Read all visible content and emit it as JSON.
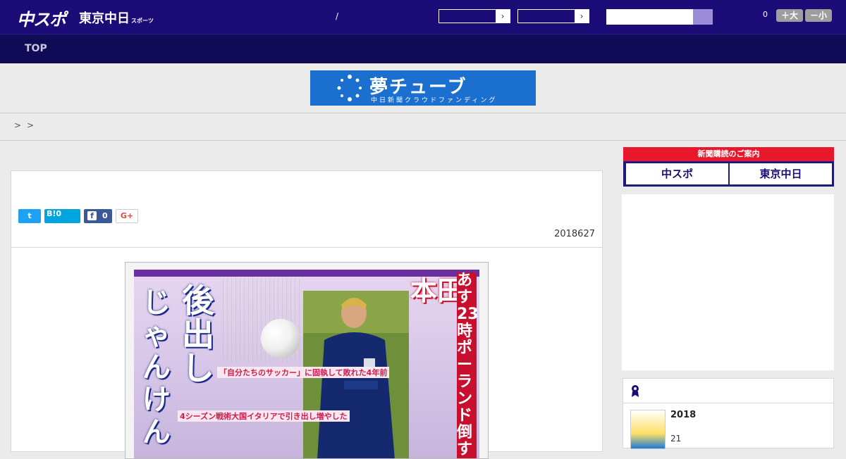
{
  "header": {
    "logo_main": "中スポ",
    "logo_sub": "東京中日",
    "logo_sub_small": "スポーツ",
    "divider": "/",
    "select_arrow_1": "›",
    "select_arrow_2": "›",
    "count": "0",
    "font_larger": "＋大",
    "font_smaller": "－小"
  },
  "nav": {
    "top_label": "TOP"
  },
  "banner": {
    "title": "夢チューブ",
    "subtitle": "中日新聞クラウドファンディング"
  },
  "breadcrumb": {
    "sep1": ">",
    "sep2": ">"
  },
  "article": {
    "share": {
      "twitter_glyph": "t",
      "hatena_label": "B!",
      "hatena_count": "0",
      "facebook_glyph": "f",
      "facebook_count": "0",
      "gplus_label": "G+"
    },
    "date": "2018627",
    "image": {
      "headline_left": "後出し",
      "headline_left2": "じゃんけん",
      "headline_right": "本田",
      "headline_right2": "あす23時ポーランド倒す",
      "caption1": "「自分たちのサッカー」に固執して敗れた4年前",
      "caption2": "4シーズン戦術大国イタリアで引き出し増やした"
    }
  },
  "sidebar": {
    "subscribe_head": "新聞購読のご案内",
    "subscribe_left": "中スポ",
    "subscribe_right": "東京中日",
    "ranking": {
      "item_title": "2018",
      "item_sub": "21"
    }
  },
  "colors": {
    "header": "#1c0c78",
    "nav": "#110a57",
    "accent_red": "#e8172c",
    "accent_purple": "#7a64c8",
    "banner_blue": "#1a6fcf"
  }
}
